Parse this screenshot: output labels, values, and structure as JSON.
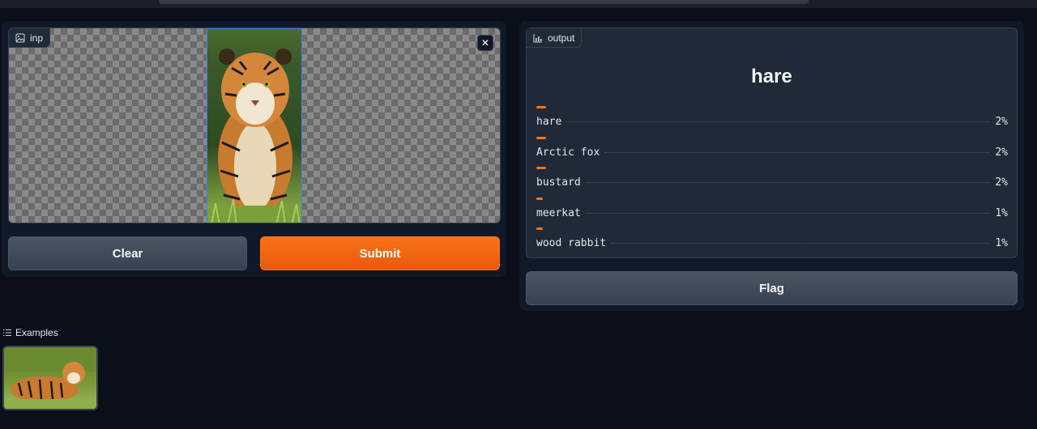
{
  "input": {
    "label": "inp",
    "clear_label": "Clear",
    "submit_label": "Submit",
    "close_symbol": "✕"
  },
  "output": {
    "label": "output",
    "top_label": "hare",
    "confidences": [
      {
        "label": "hare",
        "value": "2%",
        "fraction": 0.02
      },
      {
        "label": "Arctic fox",
        "value": "2%",
        "fraction": 0.02
      },
      {
        "label": "bustard",
        "value": "2%",
        "fraction": 0.02
      },
      {
        "label": "meerkat",
        "value": "1%",
        "fraction": 0.01
      },
      {
        "label": "wood rabbit",
        "value": "1%",
        "fraction": 0.01
      }
    ],
    "flag_label": "Flag"
  },
  "examples": {
    "label": "Examples"
  },
  "colors": {
    "accent": "#f97316",
    "background": "#0b0f19",
    "panel": "#111827"
  },
  "icons": {
    "image": "image-icon",
    "chart": "bar-chart-icon",
    "list": "list-icon",
    "close": "close-icon"
  }
}
